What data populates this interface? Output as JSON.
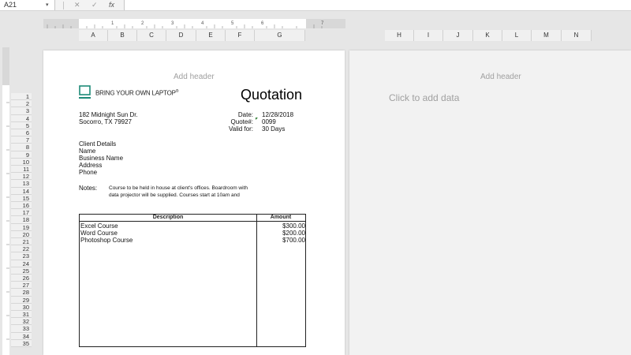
{
  "formula_bar": {
    "name_box": "A21",
    "formula": ""
  },
  "columns_left": [
    "A",
    "B",
    "C",
    "D",
    "E",
    "F",
    "G"
  ],
  "columns_right": [
    "H",
    "I",
    "J",
    "K",
    "L",
    "M",
    "N"
  ],
  "rows": [
    "1",
    "2",
    "3",
    "4",
    "5",
    "6",
    "7",
    "8",
    "9",
    "10",
    "11",
    "12",
    "13",
    "14",
    "15",
    "16",
    "17",
    "18",
    "19",
    "20",
    "21",
    "22",
    "23",
    "24",
    "25",
    "26",
    "27",
    "28",
    "29",
    "30",
    "31",
    "32",
    "33",
    "34",
    "35"
  ],
  "ruler_numbers": [
    "1",
    "2",
    "3",
    "4",
    "5",
    "6",
    "7"
  ],
  "page1": {
    "header_hint": "Add header",
    "company_name": "BRING YOUR OWN LAPTOP",
    "company_mark": "®",
    "title": "Quotation",
    "address_line1": "182 Midnight Sun Dr.",
    "address_line2": "Socorro, TX 79927",
    "date_label": "Date:",
    "date_value": "12/28/2018",
    "quote_label": "Quote#:",
    "quote_value": "0099",
    "valid_label": "Valid for:",
    "valid_value": "30 Days",
    "client_heading": "Client Details",
    "client_fields": [
      "Name",
      "Business Name",
      "Address",
      "Phone"
    ],
    "notes_label": "Notes:",
    "notes_line1": "Course to be held in house at client's offices. Boardroom with",
    "notes_line2": "data projector will be supplied. Courses start at 10am and",
    "table": {
      "headers": {
        "description": "Description",
        "amount": "Amount"
      },
      "rows": [
        {
          "description": "Excel Course",
          "amount": "$300.00"
        },
        {
          "description": "Word Course",
          "amount": "$200.00"
        },
        {
          "description": "Photoshop Course",
          "amount": "$700.00"
        }
      ]
    }
  },
  "page2": {
    "header_hint": "Add header",
    "data_hint": "Click to add data"
  },
  "colors": {
    "logo": "#1e8a78",
    "quote_marker": "#2e7d32"
  }
}
